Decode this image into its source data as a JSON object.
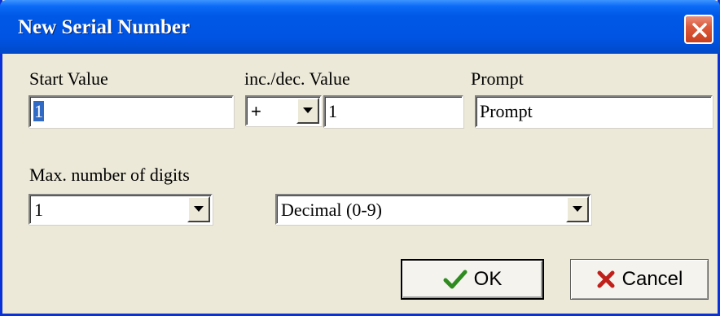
{
  "window": {
    "title": "New Serial Number"
  },
  "colors": {
    "titlebar": "#0054e3",
    "close_button": "#dc5a3c",
    "dialog_bg": "#ece9d8",
    "selection": "#316ac5",
    "ok_check": "#2e8b1f",
    "cancel_x": "#c0201a"
  },
  "fields": {
    "start_value": {
      "label": "Start Value",
      "value": "1"
    },
    "inc_dec": {
      "label": "inc./dec. Value",
      "operator": "+",
      "value": "1"
    },
    "prompt": {
      "label": "Prompt",
      "value": "Prompt"
    },
    "max_digits": {
      "label": "Max. number of digits",
      "value": "1"
    },
    "format": {
      "value": "Decimal (0-9)"
    }
  },
  "buttons": {
    "ok": {
      "label": "OK",
      "icon": "checkmark-icon"
    },
    "cancel": {
      "label": "Cancel",
      "icon": "x-mark-icon"
    }
  }
}
